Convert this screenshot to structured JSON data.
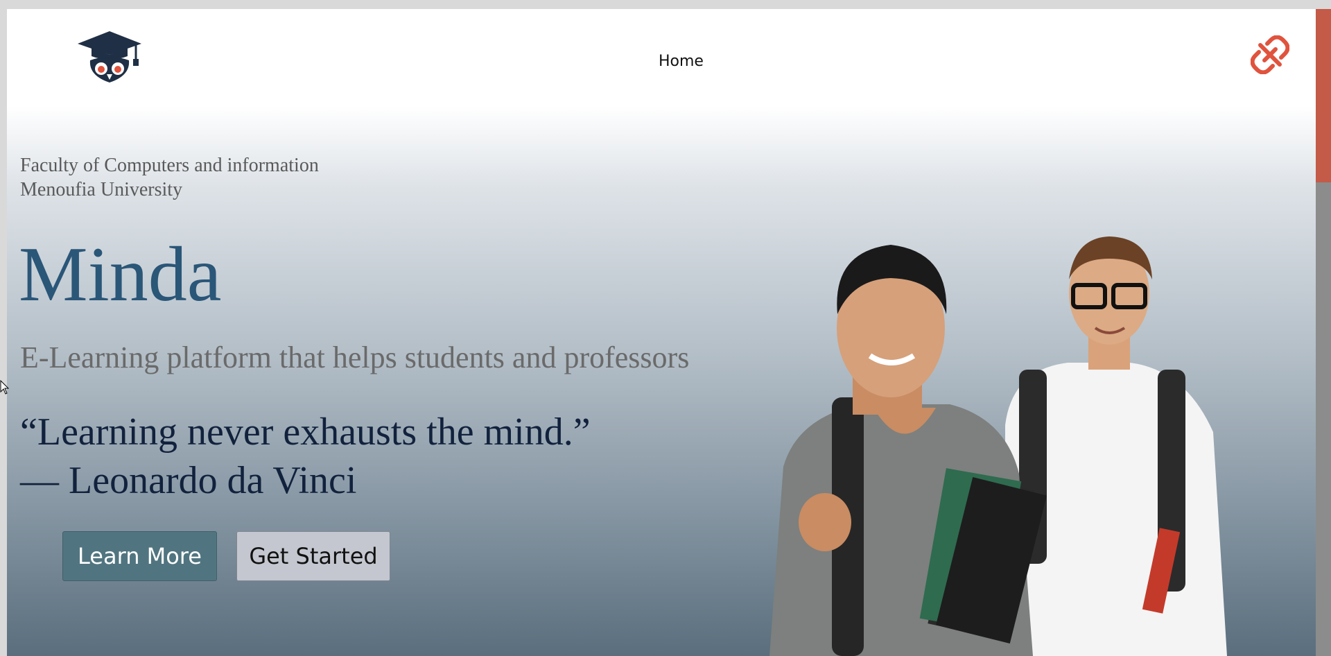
{
  "header": {
    "logo_icon": "graduation-cap-owl-icon",
    "nav_home": "Home",
    "action_icon": "unlink-icon",
    "accent_color": "#e0533d"
  },
  "hero": {
    "faculty_line1": "Faculty of Computers and information",
    "faculty_line2": "Menoufia University",
    "title": "Minda",
    "subtitle": "E-Learning platform that helps students and professors",
    "quote_line1": "“Learning never exhausts the mind.”",
    "quote_line2": "— Leonardo da Vinci",
    "learn_more": "Learn More",
    "get_started": "Get Started",
    "title_color": "#2a5678",
    "learn_more_color": "#517580",
    "get_started_color": "#c4c7cf"
  }
}
